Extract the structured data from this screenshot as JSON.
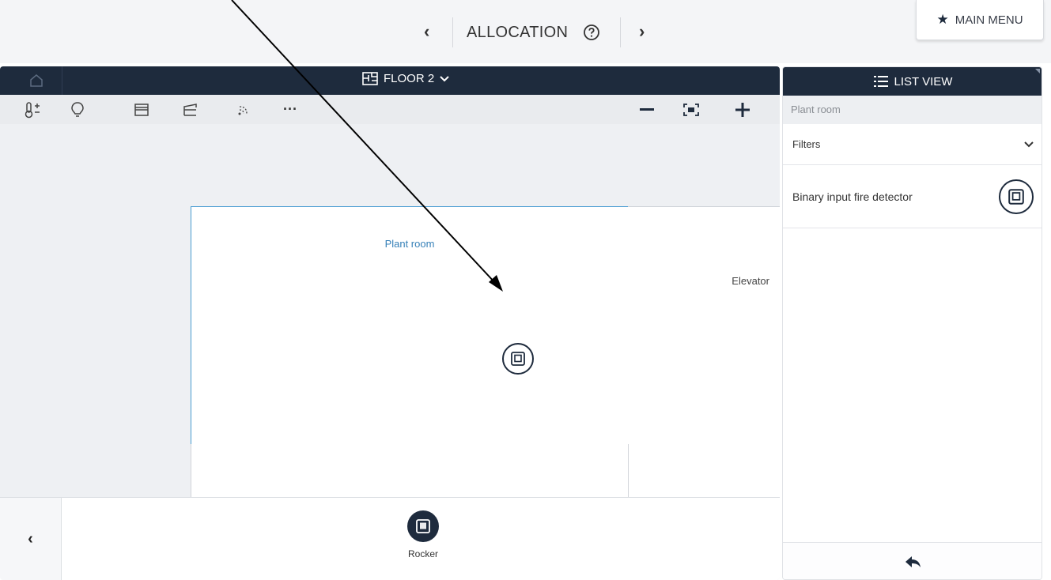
{
  "header": {
    "title": "ALLOCATION",
    "prev_icon": "chevron-left-icon",
    "next_icon": "chevron-right-icon",
    "help_icon": "question-circle-icon",
    "main_menu_label": "MAIN MENU"
  },
  "floor_panel": {
    "floor_name": "FLOOR 2",
    "toolbar_icons": [
      "thermostat-icon",
      "bulb-icon",
      "blind-icon",
      "shutter-icon",
      "wireless-icon",
      "more-icon"
    ],
    "zoom_out_icon": "minus-icon",
    "fit_icon": "fit-screen-icon",
    "zoom_in_icon": "plus-icon",
    "rooms": {
      "plant_room": "Plant room",
      "elevator": "Elevator"
    },
    "tray": {
      "device_label": "Rocker"
    }
  },
  "list_panel": {
    "header": "LIST VIEW",
    "breadcrumb": "Plant room",
    "filters_label": "Filters",
    "items": [
      {
        "label": "Binary input fire detector",
        "icon": "fire-detector-icon"
      }
    ],
    "footer_icon": "back-arrow-icon"
  },
  "colors": {
    "navy": "#1e2b3d",
    "accent_blue": "#3680b8",
    "panel_bg": "#eef0f3"
  }
}
